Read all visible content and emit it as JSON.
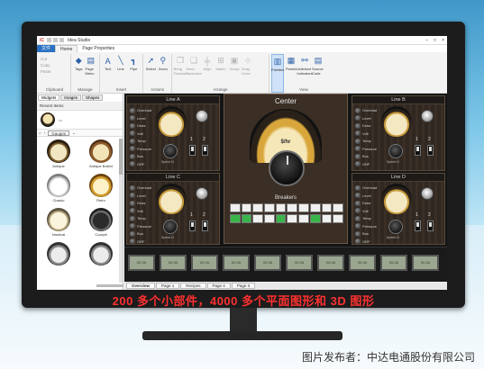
{
  "app": {
    "title": "Idea Studio"
  },
  "tabs": [
    "Home",
    "Page Properties"
  ],
  "file_tab": "文件",
  "ribbon": {
    "clipboard": {
      "label": "Clipboard",
      "items": [
        "Cut",
        "Copy",
        "Paste"
      ]
    },
    "manage": {
      "label": "Manage",
      "items": [
        "Tags",
        "Page Menu"
      ]
    },
    "insert": {
      "label": "Insert",
      "items": [
        "Text",
        "Line",
        "Pipe"
      ]
    },
    "actions": {
      "label": "Actions",
      "items": [
        "Select",
        "Zoom"
      ]
    },
    "arrange": {
      "label": "Arrange",
      "items": [
        "Bring Forward",
        "Send Backward",
        "Align",
        "Match",
        "Group",
        "Snap Lines"
      ]
    },
    "view": {
      "label": "View",
      "items": [
        "Palettes",
        "Panels",
        "Unlinked Indicators",
        "Source Code"
      ]
    }
  },
  "left_pane": {
    "tabs": [
      "Widgets",
      "Images",
      "Shapes"
    ],
    "recent_label": "Recent Items",
    "category": "Gauges",
    "items": [
      "Antique",
      "Antique Boiled",
      "Classic",
      "Retro",
      "Nautical",
      "Cockpit",
      "",
      ""
    ]
  },
  "canvas": {
    "center_title": "Center",
    "breakers_label": "Breakers",
    "unit": "$/hr",
    "panels": [
      {
        "title": "Line A"
      },
      {
        "title": "Line B"
      },
      {
        "title": "Line C"
      },
      {
        "title": "Line D"
      }
    ],
    "indicators": [
      "Overload",
      "Level",
      "Draw",
      "Volt",
      "Temp",
      "Pressure",
      "Bus",
      "GRF"
    ],
    "speed_label": "Speed Ω",
    "switch_numbers": [
      "1",
      "2"
    ],
    "meter_text": "00.0A"
  },
  "page_tabs": [
    "Overview",
    "Page 1",
    "Recipes",
    "Page 4",
    "Page 3"
  ],
  "caption": "200 多个小部件，4000 多个平面图形和 3D 图形",
  "credit": "图片发布者：中达电通股份有限公司",
  "colors": {
    "accent": "#2b72c2",
    "caption": "#ff3030"
  }
}
